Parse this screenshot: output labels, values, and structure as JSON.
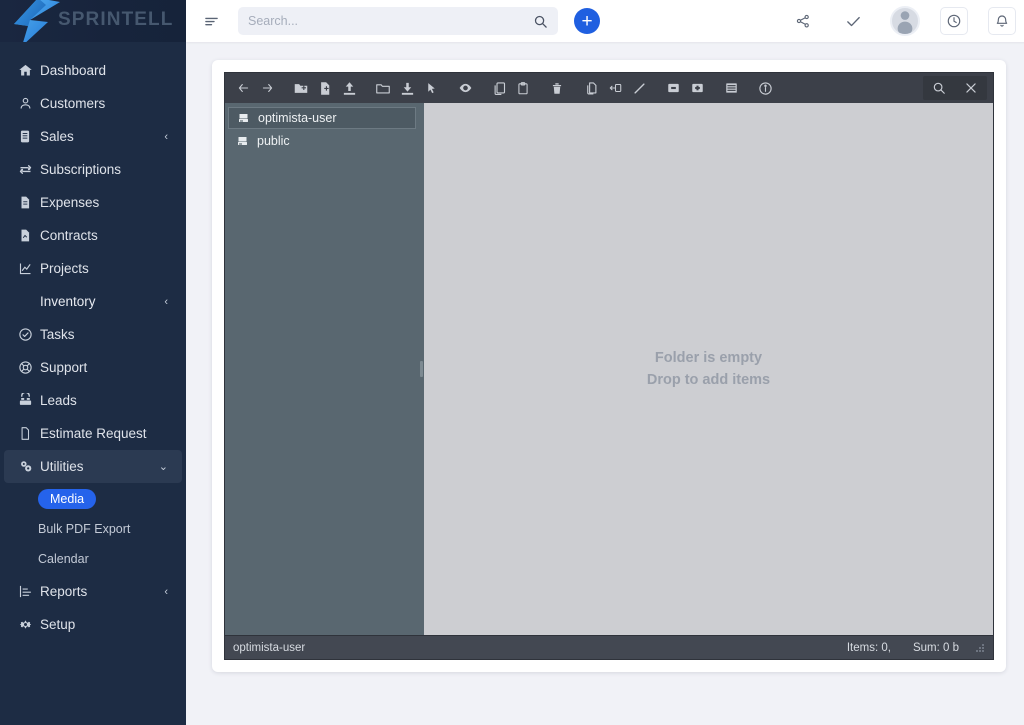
{
  "brand": {
    "name": "SPRINTELL",
    "logo_icon": "sprintell-logo-icon"
  },
  "sidebar": {
    "items": [
      {
        "label": "Dashboard",
        "icon": "home-icon",
        "type": "link"
      },
      {
        "label": "Customers",
        "icon": "user-icon",
        "type": "link"
      },
      {
        "label": "Sales",
        "icon": "clipboard-icon",
        "type": "group",
        "chevron": "‹"
      },
      {
        "label": "Subscriptions",
        "icon": "refresh-icon",
        "type": "link"
      },
      {
        "label": "Expenses",
        "icon": "file-icon",
        "type": "link"
      },
      {
        "label": "Contracts",
        "icon": "contract-icon",
        "type": "link"
      },
      {
        "label": "Projects",
        "icon": "chart-icon",
        "type": "link"
      },
      {
        "label": "Inventory",
        "icon": "",
        "type": "group",
        "chevron": "‹"
      },
      {
        "label": "Tasks",
        "icon": "check-circle-icon",
        "type": "link"
      },
      {
        "label": "Support",
        "icon": "lifebuoy-icon",
        "type": "link"
      },
      {
        "label": "Leads",
        "icon": "phone-icon",
        "type": "link"
      },
      {
        "label": "Estimate Request",
        "icon": "document-icon",
        "type": "link"
      },
      {
        "label": "Utilities",
        "icon": "gears-icon",
        "type": "group-open",
        "chevron": "⌄",
        "active": true
      },
      {
        "label": "Reports",
        "icon": "report-icon",
        "type": "group",
        "chevron": "‹"
      },
      {
        "label": "Setup",
        "icon": "gear-icon",
        "type": "link"
      }
    ],
    "utilities_children": [
      {
        "label": "Media",
        "selected": true
      },
      {
        "label": "Bulk PDF Export",
        "selected": false
      },
      {
        "label": "Calendar",
        "selected": false
      }
    ],
    "accent_color": "#2563eb",
    "background_color": "#1d2c44"
  },
  "topbar": {
    "menu_icon": "hamburger-menu-icon",
    "search": {
      "placeholder": "Search...",
      "value": "",
      "icon": "search-icon"
    },
    "add_button": {
      "label": "+",
      "icon": "plus-icon",
      "color": "#1f5fe0"
    },
    "right_icons": [
      {
        "name": "share-icon",
        "glyph": "share"
      },
      {
        "name": "check-icon",
        "glyph": "check"
      },
      {
        "name": "avatar",
        "glyph": "user"
      },
      {
        "name": "clock-icon",
        "glyph": "clock"
      },
      {
        "name": "bell-icon",
        "glyph": "bell"
      }
    ]
  },
  "file_manager": {
    "toolbar": [
      {
        "name": "back-icon",
        "title": "Back"
      },
      {
        "name": "forward-icon",
        "title": "Forward"
      },
      {
        "name": "new-folder-icon",
        "title": "New folder"
      },
      {
        "name": "new-file-icon",
        "title": "New file"
      },
      {
        "name": "upload-icon",
        "title": "Upload"
      },
      {
        "name": "open-folder-icon",
        "title": "Open"
      },
      {
        "name": "download-icon",
        "title": "Download"
      },
      {
        "name": "select-cursor-icon",
        "title": "Select"
      },
      {
        "name": "preview-eye-icon",
        "title": "Preview"
      },
      {
        "name": "copy-icon",
        "title": "Copy"
      },
      {
        "name": "paste-icon",
        "title": "Paste"
      },
      {
        "name": "delete-trash-icon",
        "title": "Delete"
      },
      {
        "name": "duplicate-icon",
        "title": "Duplicate"
      },
      {
        "name": "rename-box-icon",
        "title": "Rename"
      },
      {
        "name": "edit-pencil-icon",
        "title": "Edit"
      },
      {
        "name": "zoom-out-icon",
        "title": "Zoom out"
      },
      {
        "name": "zoom-in-icon",
        "title": "Zoom in"
      },
      {
        "name": "list-view-icon",
        "title": "List view"
      },
      {
        "name": "info-icon",
        "title": "Info"
      }
    ],
    "toolbar_right": [
      {
        "name": "fm-search-icon",
        "title": "Search"
      },
      {
        "name": "fm-close-icon",
        "title": "Close"
      }
    ],
    "tree": [
      {
        "label": "optimista-user",
        "icon": "drive-icon",
        "selected": true
      },
      {
        "label": "public",
        "icon": "drive-icon",
        "selected": false
      }
    ],
    "empty_state": {
      "line1": "Folder is empty",
      "line2": "Drop to add items"
    },
    "status": {
      "path": "optimista-user",
      "items": "Items: 0,",
      "sum": "Sum: 0 b"
    },
    "colors": {
      "toolbar": "#3c4049",
      "tree": "#596770",
      "content": "#cdced2",
      "status": "#434852"
    }
  }
}
